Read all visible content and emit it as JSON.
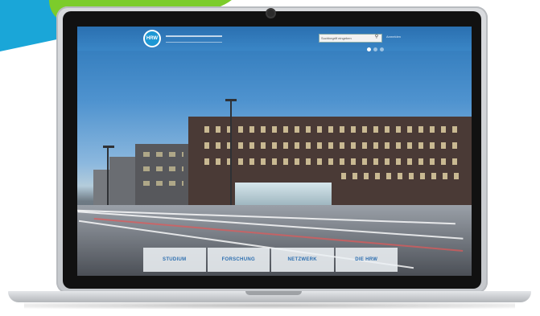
{
  "website": {
    "logo_text": "HRW",
    "search_placeholder": "Suchbegriff eingeben",
    "top_link": "Anmelden",
    "nav": [
      {
        "label": "STUDIUM"
      },
      {
        "label": "FORSCHUNG"
      },
      {
        "label": "NETZWERK"
      },
      {
        "label": "DIE HRW"
      }
    ]
  },
  "colors": {
    "swoosh_blue": "#1aa6d8",
    "swoosh_green": "#7ccc2b",
    "brand_blue": "#2a6fb0",
    "nav_text": "#2e6fb0"
  },
  "icons": [
    "search-icon"
  ]
}
